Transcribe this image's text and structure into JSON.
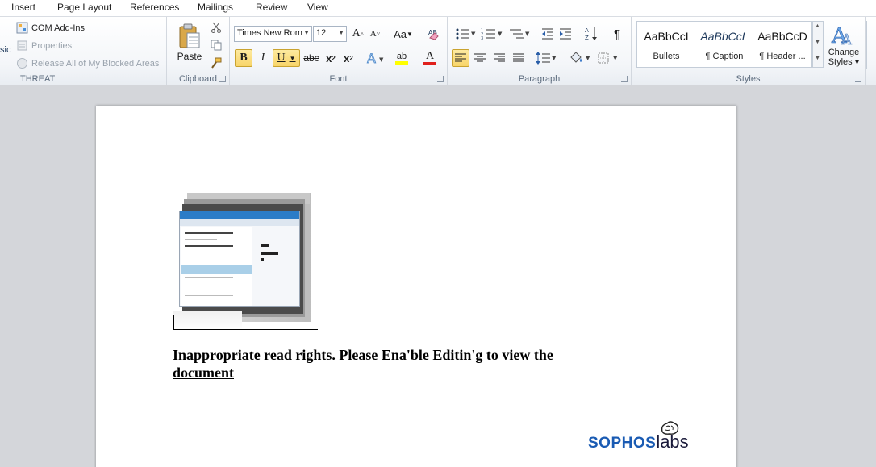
{
  "tabs": [
    "Insert",
    "Page Layout",
    "References",
    "Mailings",
    "Review",
    "View"
  ],
  "threat_group": {
    "cut_label": "sic",
    "com_addins": "COM Add-Ins",
    "properties": "Properties",
    "release": "Release All of My Blocked Areas",
    "label": "THREAT"
  },
  "clipboard": {
    "paste": "Paste",
    "label": "Clipboard"
  },
  "font": {
    "name": "Times New Rom",
    "size": "12",
    "label": "Font",
    "bold": "B",
    "italic": "I",
    "underline": "U",
    "strike": "abc",
    "change_case": "Aa",
    "highlight_letters": "ab"
  },
  "paragraph": {
    "label": "Paragraph",
    "pilcrow": "¶"
  },
  "styles": {
    "label": "Styles",
    "items": [
      {
        "sample": "AaBbCcI",
        "name": "Bullets"
      },
      {
        "sample": "AaBbCcL",
        "name": "¶ Caption"
      },
      {
        "sample": "AaBbCcD",
        "name": "¶ Header ..."
      }
    ],
    "change_styles_1": "Change",
    "change_styles_2": "Styles"
  },
  "document": {
    "message_line1": "Inappropriate  read rights. Please Ena'ble  Editin'g  to view the",
    "message_line2": "document",
    "logo_part1": "SOPHOS",
    "logo_part2": "labs"
  },
  "colors": {
    "highlight": "#f8d468",
    "logo_blue": "#1a5bb3",
    "font_color_bar": "#e0201c",
    "highlight_bar": "#ffff00"
  }
}
